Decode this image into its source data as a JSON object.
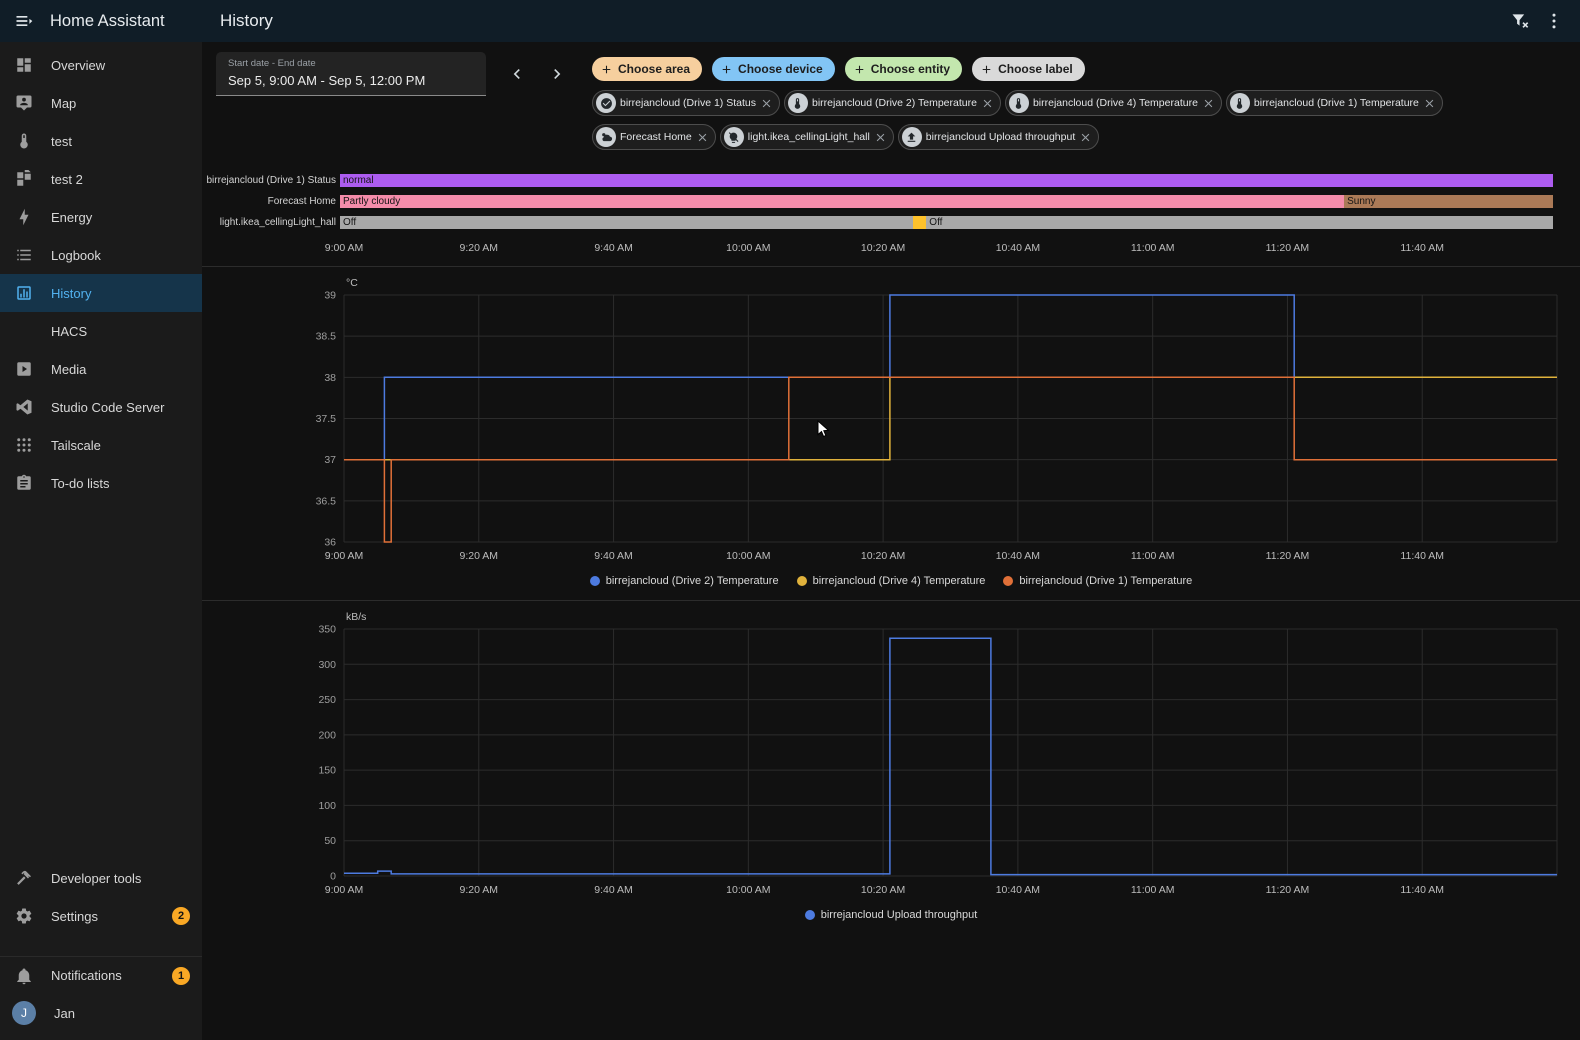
{
  "app": {
    "title": "Home Assistant"
  },
  "topbar": {
    "title": "History"
  },
  "sidebar": {
    "items": [
      {
        "label": "Overview",
        "icon": "view-dashboard"
      },
      {
        "label": "Map",
        "icon": "map-account"
      },
      {
        "label": "test",
        "icon": "thermometer"
      },
      {
        "label": "test 2",
        "icon": "view-grid"
      },
      {
        "label": "Energy",
        "icon": "lightning"
      },
      {
        "label": "Logbook",
        "icon": "list"
      },
      {
        "label": "History",
        "icon": "chart",
        "selected": true
      },
      {
        "label": "HACS",
        "icon": "none"
      },
      {
        "label": "Media",
        "icon": "play-box"
      },
      {
        "label": "Studio Code Server",
        "icon": "code"
      },
      {
        "label": "Tailscale",
        "icon": "dots-grid"
      },
      {
        "label": "To-do lists",
        "icon": "clipboard"
      }
    ],
    "bottom_items": [
      {
        "label": "Developer tools",
        "icon": "hammer"
      },
      {
        "label": "Settings",
        "icon": "gear",
        "badge": "2"
      },
      {
        "label": "Notifications",
        "icon": "bell",
        "badge": "1",
        "divider_before": true
      },
      {
        "label": "Jan",
        "icon": "avatar",
        "avatar_letter": "J",
        "avatar_color": "#5b7fa6"
      }
    ],
    "badge_color": "#f9a825"
  },
  "filters": {
    "date_label": "Start date - End date",
    "date_value": "Sep 5, 9:00 AM - Sep 5, 12:00 PM",
    "choosers": [
      {
        "label": "Choose area",
        "color": "#f6cf9e"
      },
      {
        "label": "Choose device",
        "color": "#82c5f5"
      },
      {
        "label": "Choose entity",
        "color": "#c3e7ae"
      },
      {
        "label": "Choose label",
        "color": "#d9d9d9"
      }
    ],
    "entities": [
      {
        "label": "birrejancloud (Drive 1) Status",
        "icon": "check-circle"
      },
      {
        "label": "birrejancloud (Drive 2) Temperature",
        "icon": "thermometer"
      },
      {
        "label": "birrejancloud (Drive 4) Temperature",
        "icon": "thermometer"
      },
      {
        "label": "birrejancloud (Drive 1) Temperature",
        "icon": "thermometer"
      },
      {
        "label": "Forecast Home",
        "icon": "weather-partly-cloudy"
      },
      {
        "label": "light.ikea_cellingLight_hall",
        "icon": "lightbulb-off"
      },
      {
        "label": "birrejancloud Upload throughput",
        "icon": "upload"
      }
    ]
  },
  "time_axis": {
    "start_min": 0,
    "end_min": 180,
    "tick_step_min": 20,
    "tick_labels": [
      "9:00 AM",
      "9:20 AM",
      "9:40 AM",
      "10:00 AM",
      "10:20 AM",
      "10:40 AM",
      "11:00 AM",
      "11:20 AM",
      "11:40 AM"
    ]
  },
  "timeline": {
    "rows": [
      {
        "label": "birrejancloud (Drive 1) Status",
        "segments": [
          {
            "text": "normal",
            "color": "#ad5cf0",
            "start_min": 0,
            "end_min": 180
          }
        ]
      },
      {
        "label": "Forecast Home",
        "segments": [
          {
            "text": "Partly cloudy",
            "color": "#f48caa",
            "start_min": 0,
            "end_min": 149
          },
          {
            "text": "Sunny",
            "color": "#ab7a57",
            "start_min": 149,
            "end_min": 180
          }
        ]
      },
      {
        "label": "light.ikea_cellingLight_hall",
        "segments": [
          {
            "text": "Off",
            "color": "#a8a8a8",
            "start_min": 0,
            "end_min": 85
          },
          {
            "text": "",
            "color": "#fdc12b",
            "start_min": 85,
            "end_min": 87
          },
          {
            "text": "Off",
            "color": "#a8a8a8",
            "start_min": 87,
            "end_min": 180
          }
        ]
      }
    ]
  },
  "chart_data": [
    {
      "type": "line",
      "step": true,
      "unit": "°C",
      "ylim": [
        36,
        39
      ],
      "y_ticks": [
        36,
        36.5,
        37,
        37.5,
        38,
        38.5,
        39
      ],
      "series": [
        {
          "name": "birrejancloud (Drive 2) Temperature",
          "color": "#4d7be0",
          "points_min_value": [
            [
              0,
              37
            ],
            [
              6,
              38
            ],
            [
              81,
              39
            ],
            [
              141,
              38
            ]
          ]
        },
        {
          "name": "birrejancloud (Drive 4) Temperature",
          "color": "#e0b23c",
          "points_min_value": [
            [
              0,
              37
            ],
            [
              81,
              38
            ]
          ]
        },
        {
          "name": "birrejancloud (Drive 1) Temperature",
          "color": "#e07038",
          "points_min_value": [
            [
              0,
              37
            ],
            [
              6,
              36
            ],
            [
              7,
              37
            ],
            [
              66,
              38
            ],
            [
              141,
              37
            ]
          ]
        }
      ]
    },
    {
      "type": "line",
      "step": true,
      "unit": "kB/s",
      "ylim": [
        0,
        350
      ],
      "y_ticks": [
        0,
        50,
        100,
        150,
        200,
        250,
        300,
        350
      ],
      "series": [
        {
          "name": "birrejancloud Upload throughput",
          "color": "#4d7be0",
          "points_min_value": [
            [
              0,
              4
            ],
            [
              5,
              7
            ],
            [
              7,
              3
            ],
            [
              81,
              337
            ],
            [
              96,
              2
            ]
          ]
        }
      ]
    }
  ]
}
